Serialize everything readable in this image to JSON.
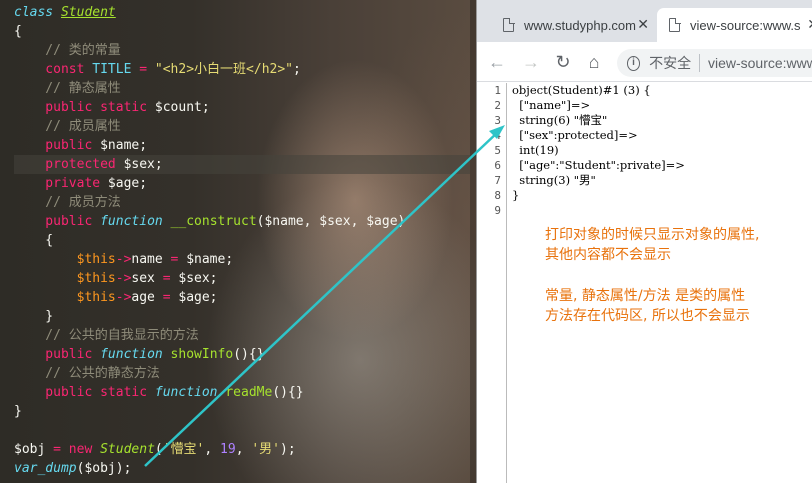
{
  "editor": {
    "lines": [
      [
        {
          "t": "class",
          "c": "t-kwi"
        },
        {
          "t": " ",
          "c": "t-plain"
        },
        {
          "t": "Student",
          "c": "t-cls"
        }
      ],
      [
        {
          "t": "{",
          "c": "t-plain"
        }
      ],
      [
        {
          "t": "    // 类的常量",
          "c": "t-com"
        }
      ],
      [
        {
          "t": "    const",
          "c": "t-kw"
        },
        {
          "t": " TITLE ",
          "c": "t-const"
        },
        {
          "t": "=",
          "c": "t-op"
        },
        {
          "t": " \"<h2>小白一班</h2>\"",
          "c": "t-str"
        },
        {
          "t": ";",
          "c": "t-plain"
        }
      ],
      [
        {
          "t": "    // 静态属性",
          "c": "t-com"
        }
      ],
      [
        {
          "t": "    public static",
          "c": "t-kw"
        },
        {
          "t": " $count;",
          "c": "t-plain"
        }
      ],
      [
        {
          "t": "    // 成员属性",
          "c": "t-com"
        }
      ],
      [
        {
          "t": "    public",
          "c": "t-kw"
        },
        {
          "t": " $name;",
          "c": "t-plain"
        }
      ],
      [
        {
          "t": "    protected",
          "c": "t-kw"
        },
        {
          "t": " $sex;",
          "c": "t-plain"
        }
      ],
      [
        {
          "t": "    private",
          "c": "t-kw"
        },
        {
          "t": " $age;",
          "c": "t-plain"
        }
      ],
      [
        {
          "t": "    // 成员方法",
          "c": "t-com"
        }
      ],
      [
        {
          "t": "    public",
          "c": "t-kw"
        },
        {
          "t": " function",
          "c": "t-ital"
        },
        {
          "t": " __construct",
          "c": "t-fn"
        },
        {
          "t": "($name, $sex, $age)",
          "c": "t-plain"
        }
      ],
      [
        {
          "t": "    {",
          "c": "t-plain"
        }
      ],
      [
        {
          "t": "        $this",
          "c": "t-this"
        },
        {
          "t": "->",
          "c": "t-op"
        },
        {
          "t": "name ",
          "c": "t-plain"
        },
        {
          "t": "=",
          "c": "t-op"
        },
        {
          "t": " $name;",
          "c": "t-plain"
        }
      ],
      [
        {
          "t": "        $this",
          "c": "t-this"
        },
        {
          "t": "->",
          "c": "t-op"
        },
        {
          "t": "sex ",
          "c": "t-plain"
        },
        {
          "t": "=",
          "c": "t-op"
        },
        {
          "t": " $sex;",
          "c": "t-plain"
        }
      ],
      [
        {
          "t": "        $this",
          "c": "t-this"
        },
        {
          "t": "->",
          "c": "t-op"
        },
        {
          "t": "age ",
          "c": "t-plain"
        },
        {
          "t": "=",
          "c": "t-op"
        },
        {
          "t": " $age;",
          "c": "t-plain"
        }
      ],
      [
        {
          "t": "    }",
          "c": "t-plain"
        }
      ],
      [
        {
          "t": "    // 公共的自我显示的方法",
          "c": "t-com"
        }
      ],
      [
        {
          "t": "    public",
          "c": "t-kw"
        },
        {
          "t": " function",
          "c": "t-ital"
        },
        {
          "t": " showInfo",
          "c": "t-fn"
        },
        {
          "t": "(){}",
          "c": "t-plain"
        }
      ],
      [
        {
          "t": "    // 公共的静态方法",
          "c": "t-com"
        }
      ],
      [
        {
          "t": "    public static",
          "c": "t-kw"
        },
        {
          "t": " function",
          "c": "t-ital"
        },
        {
          "t": " readMe",
          "c": "t-fn"
        },
        {
          "t": "(){}",
          "c": "t-plain"
        }
      ],
      [
        {
          "t": "}",
          "c": "t-plain"
        }
      ],
      [],
      [
        {
          "t": "$obj ",
          "c": "t-plain"
        },
        {
          "t": "=",
          "c": "t-op"
        },
        {
          "t": " new",
          "c": "t-kw"
        },
        {
          "t": " Student",
          "c": "t-clsi"
        },
        {
          "t": "(",
          "c": "t-plain"
        },
        {
          "t": "'懵宝'",
          "c": "t-str"
        },
        {
          "t": ", ",
          "c": "t-plain"
        },
        {
          "t": "19",
          "c": "t-num"
        },
        {
          "t": ", ",
          "c": "t-plain"
        },
        {
          "t": "'男'",
          "c": "t-str"
        },
        {
          "t": ");",
          "c": "t-plain"
        }
      ],
      [
        {
          "t": "var_dump",
          "c": "t-ital"
        },
        {
          "t": "($obj);",
          "c": "t-plain"
        }
      ]
    ],
    "highlighted_line": 8
  },
  "browser": {
    "tabs": [
      {
        "title": "www.studyphp.com",
        "close": "✕"
      },
      {
        "title": "view-source:www.s",
        "close": "✕"
      }
    ],
    "nav": {
      "back": "←",
      "forward": "→",
      "reload": "↻",
      "home": "⌂"
    },
    "security_label": "不安全",
    "url": "view-source:www.s",
    "line_numbers": [
      "1",
      "2",
      "3",
      "4",
      "5",
      "6",
      "7",
      "8",
      "9"
    ],
    "source_lines": [
      "object(Student)#1 (3) {",
      "  [\"name\"]=>",
      "  string(6) \"懵宝\"",
      "  [\"sex\":protected]=>",
      "  int(19)",
      "  [\"age\":\"Student\":private]=>",
      "  string(3) \"男\"",
      "}",
      ""
    ],
    "notes": [
      "打印对象的时候只显示对象的属性,",
      "其他内容都不会显示",
      "常量, 静态属性/方法 是类的属性",
      "方法存在代码区, 所以也不会显示"
    ]
  },
  "colors": {
    "annotation": "#e8720c",
    "arrow": "#2ec4c8"
  }
}
